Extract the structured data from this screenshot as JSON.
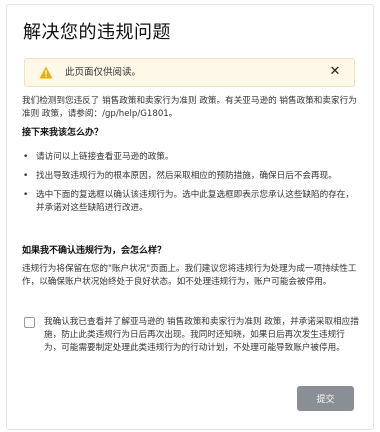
{
  "title": "解决您的违规问题",
  "alert": {
    "icon": "warning-icon",
    "text": "此页面仅供阅读。",
    "close_icon": "close-icon",
    "close_glyph": "✕",
    "accent_color": "#f0ad00"
  },
  "intro": "我们检测到您违反了 销售政策和卖家行为准则 政策。有关亚马逊的 销售政策和卖家行为准则 政策，请参阅：/gp/help/G1801。",
  "next_steps": {
    "heading": "接下来我该怎么办？",
    "items": [
      "请访问以上链接查看亚马逊的政策。",
      "找出导致违规行为的根本原因，然后采取相应的预防措施，确保日后不会再现。",
      "选中下面的复选框以确认该违规行为。选中此复选框即表示您承认这些缺陷的存在，并承诺对这些缺陷进行改进。"
    ]
  },
  "unsure": {
    "heading": "如果我不确认违规行为，会怎么样？",
    "text": "违规行为将保留在您的\"账户状况\"页面上。我们建议您将违规行为处理为成一项持续性工作，以确保账户状况始终处于良好状态。如不处理违规行为，账户可能会被停用。"
  },
  "acknowledge": {
    "text": "我确认我已查看并了解亚马逊的 销售政策和卖家行为准则 政策，并承诺采取相应措施，防止此类违规行为日后再次出现。我同时还知晓，如果日后再次发生违规行为，可能需要制定处理此类违规行为的行动计划，不处理可能导致账户被停用。",
    "checked": false
  },
  "submit_label": "提交",
  "bullet_glyph": "•",
  "colors": {
    "submit_bg": "#8a8f95",
    "alert_bg": "#fef8e8"
  }
}
